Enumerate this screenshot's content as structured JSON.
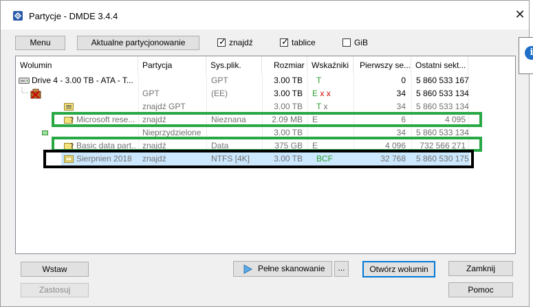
{
  "window": {
    "title": "Partycje - DMDE 3.4.4",
    "close_glyph": "✕"
  },
  "toolbar": {
    "menu_label": "Menu",
    "current_partitioning_label": "Aktualne partycjonowanie",
    "find_label": "znajdź",
    "find_checked": true,
    "tables_label": "tablice",
    "tables_checked": true,
    "gib_label": "GiB",
    "gib_checked": false,
    "check_glyph": "✓"
  },
  "columns": [
    "Wolumin",
    "Partycja",
    "Sys.plik.",
    "Rozmiar",
    "Wskaźniki",
    "Pierwszy se...",
    "Ostatni sekt..."
  ],
  "rows": [
    {
      "wolumin": "Drive 4 - 3.00 TB - ATA - T...",
      "partycja": "",
      "sys": "GPT",
      "rozmiar": "3.00 TB",
      "wsk": "T",
      "first": "0",
      "last": "5 860 533 167"
    },
    {
      "wolumin": "",
      "partycja": "GPT",
      "sys": "(EE)",
      "rozmiar": "3.00 TB",
      "wsk": "E x x",
      "first": "34",
      "last": "5 860 533 134"
    },
    {
      "wolumin": "",
      "partycja": "znajdź GPT",
      "sys": "",
      "rozmiar": "3.00 TB",
      "wsk": "T x",
      "first": "34",
      "last": "5 860 533 134"
    },
    {
      "wolumin": "Microsoft rese...",
      "partycja": "znajdź",
      "sys": "Nieznana",
      "rozmiar": "2.09 MB",
      "wsk": "E",
      "first": "6",
      "last": "4 095"
    },
    {
      "wolumin": "",
      "partycja": "Nieprzydzielone",
      "sys": "",
      "rozmiar": "3.00 TB",
      "wsk": "",
      "first": "34",
      "last": "5 860 533 134"
    },
    {
      "wolumin": "Basic data part...",
      "partycja": "znajdź",
      "sys": "Data",
      "rozmiar": "375 GB",
      "wsk": "E",
      "first": "4 096",
      "last": "732 566 271"
    },
    {
      "wolumin": "Sierpnien 2018",
      "partycja": "znajdź",
      "sys": "NTFS [4K]",
      "rozmiar": "3.00 TB",
      "wsk": "BCF",
      "first": "32 768",
      "last": "5 860 530 175"
    }
  ],
  "buttons": {
    "insert": "Wstaw",
    "apply": "Zastosuj",
    "full_scan": "Pełne skanowanie",
    "ellipsis": "...",
    "open_volume": "Otwórz wolumin",
    "close": "Zamknij",
    "help": "Pomoc"
  },
  "tooltip": {
    "icon_glyph": "i"
  },
  "colors": {
    "highlight_green": "#27a844",
    "highlight_black": "#000000",
    "selection": "#cce8ff",
    "accent": "#0078d7"
  }
}
